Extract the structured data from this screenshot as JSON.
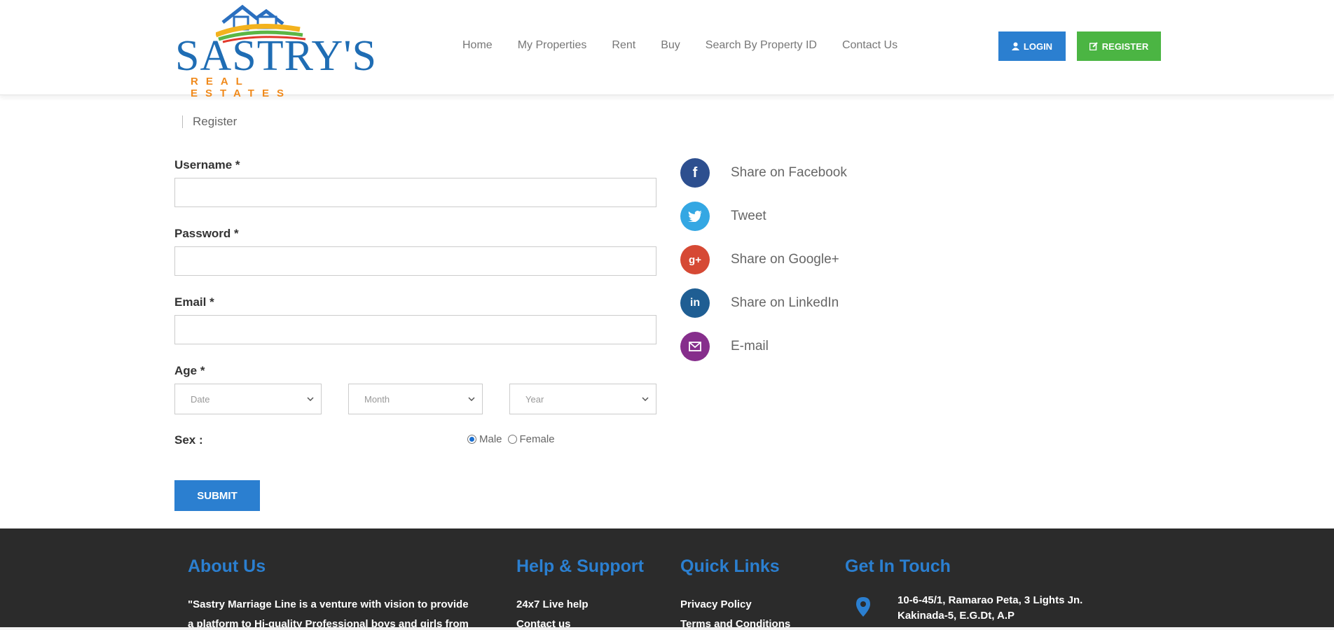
{
  "brand": {
    "logo_text": "SASTRY'S",
    "logo_sub": "REAL ESTATES"
  },
  "nav": {
    "items": [
      {
        "label": "Home"
      },
      {
        "label": "My Properties"
      },
      {
        "label": "Rent"
      },
      {
        "label": "Buy"
      },
      {
        "label": "Search By Property ID"
      },
      {
        "label": "Contact Us"
      }
    ],
    "login_label": "LOGIN",
    "register_label": "REGISTER"
  },
  "breadcrumb": {
    "current": "Register"
  },
  "form": {
    "username_label": "Username *",
    "password_label": "Password *",
    "email_label": "Email *",
    "age_label": "Age *",
    "age_date_placeholder": "Date",
    "age_month_placeholder": "Month",
    "age_year_placeholder": "Year",
    "sex_label": "Sex :",
    "sex_options": {
      "male": "Male",
      "female": "Female"
    },
    "selected_sex": "Male",
    "submit_label": "SUBMIT"
  },
  "share": {
    "items": [
      {
        "label": "Share on Facebook",
        "icon": "facebook-icon",
        "color": "#2d4f8f"
      },
      {
        "label": "Tweet",
        "icon": "twitter-icon",
        "color": "#34a7e3"
      },
      {
        "label": "Share on Google+",
        "icon": "google-plus-icon",
        "color": "#d64934"
      },
      {
        "label": "Share on LinkedIn",
        "icon": "linkedin-icon",
        "color": "#1f5e93"
      },
      {
        "label": "E-mail",
        "icon": "email-icon",
        "color": "#862e8c"
      }
    ]
  },
  "footer": {
    "about_title": "About Us",
    "about_text_line1": "\"Sastry Marriage Line is a venture with vision to provide",
    "about_text_line2": "a platform to Hi-quality Professional boys and girls from",
    "help_title": "Help & Support",
    "help_links": [
      "24x7 Live help",
      "Contact us"
    ],
    "quick_title": "Quick Links",
    "quick_links": [
      "Privacy Policy",
      "Terms and Conditions"
    ],
    "touch_title": "Get In Touch",
    "address_line1": "10-6-45/1, Ramarao Peta, 3 Lights Jn.",
    "address_line2": "Kakinada-5, E.G.Dt, A.P"
  },
  "colors": {
    "primary": "#2b7fd0",
    "success": "#4bb543",
    "footer_bg": "#2b2b2b"
  }
}
